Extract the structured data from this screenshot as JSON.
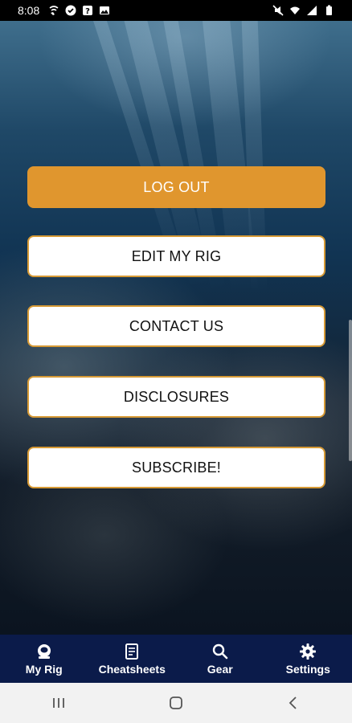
{
  "status_bar": {
    "time": "8:08",
    "left_icons": [
      "wifi-calling-icon",
      "check-circle-icon",
      "help-box-icon",
      "image-icon"
    ],
    "right_icons": [
      "mute-icon",
      "wifi-icon",
      "signal-icon",
      "battery-icon"
    ]
  },
  "menu": {
    "logout_label": "LOG OUT",
    "edit_rig_label": "EDIT MY RIG",
    "contact_label": "CONTACT US",
    "disclosures_label": "DISCLOSURES",
    "subscribe_label": "SUBSCRIBE!"
  },
  "bottom_nav": {
    "items": [
      {
        "label": "My Rig",
        "icon": "diving-helmet-icon"
      },
      {
        "label": "Cheatsheets",
        "icon": "document-icon"
      },
      {
        "label": "Gear",
        "icon": "search-icon"
      },
      {
        "label": "Settings",
        "icon": "gear-icon"
      }
    ]
  },
  "colors": {
    "primary": "#e0962e",
    "nav_background": "#0b1b4a",
    "button_border": "#d79a35"
  }
}
